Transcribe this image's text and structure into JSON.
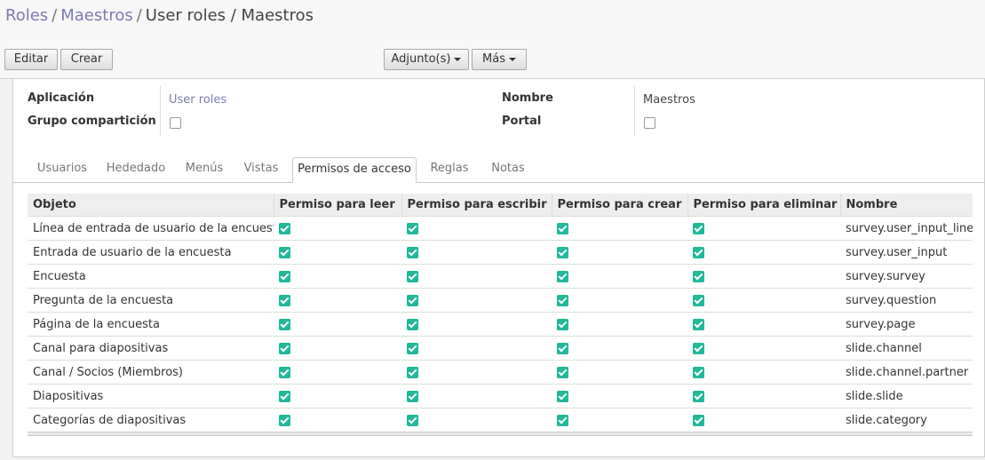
{
  "breadcrumb": {
    "items": [
      "Roles",
      "Maestros"
    ],
    "separator": "/",
    "current": "User roles / Maestros"
  },
  "buttons": {
    "edit": "Editar",
    "create": "Crear",
    "attachments": "Adjunto(s)",
    "more": "Más"
  },
  "form": {
    "app_label": "Aplicación",
    "app_value": "User roles",
    "share_group_label": "Grupo compartición",
    "share_group_checked": false,
    "name_label": "Nombre",
    "name_value": "Maestros",
    "portal_label": "Portal",
    "portal_checked": false
  },
  "tabs": [
    "Usuarios",
    "Hededado",
    "Menús",
    "Vistas",
    "Permisos de acceso",
    "Reglas",
    "Notas"
  ],
  "active_tab": "Permisos de acceso",
  "table": {
    "columns": [
      "Objeto",
      "Permiso para leer",
      "Permiso para escribir",
      "Permiso para crear",
      "Permiso para eliminar",
      "Nombre"
    ],
    "rows": [
      {
        "object": "Línea de entrada de usuario de la encuesta",
        "read": true,
        "write": true,
        "create": true,
        "unlink": true,
        "name": "survey.user_input_line"
      },
      {
        "object": "Entrada de usuario de la encuesta",
        "read": true,
        "write": true,
        "create": true,
        "unlink": true,
        "name": "survey.user_input"
      },
      {
        "object": "Encuesta",
        "read": true,
        "write": true,
        "create": true,
        "unlink": true,
        "name": "survey.survey"
      },
      {
        "object": "Pregunta de la encuesta",
        "read": true,
        "write": true,
        "create": true,
        "unlink": true,
        "name": "survey.question"
      },
      {
        "object": "Página de la encuesta",
        "read": true,
        "write": true,
        "create": true,
        "unlink": true,
        "name": "survey.page"
      },
      {
        "object": "Canal para diapositivas",
        "read": true,
        "write": true,
        "create": true,
        "unlink": true,
        "name": "slide.channel"
      },
      {
        "object": "Canal / Socios (Miembros)",
        "read": true,
        "write": true,
        "create": true,
        "unlink": true,
        "name": "slide.channel.partner"
      },
      {
        "object": "Diapositivas",
        "read": true,
        "write": true,
        "create": true,
        "unlink": true,
        "name": "slide.slide"
      },
      {
        "object": "Categorías de diapositivas",
        "read": true,
        "write": true,
        "create": true,
        "unlink": true,
        "name": "slide.category"
      }
    ]
  },
  "colors": {
    "link": "#7c7bad",
    "check": "#21b799"
  }
}
